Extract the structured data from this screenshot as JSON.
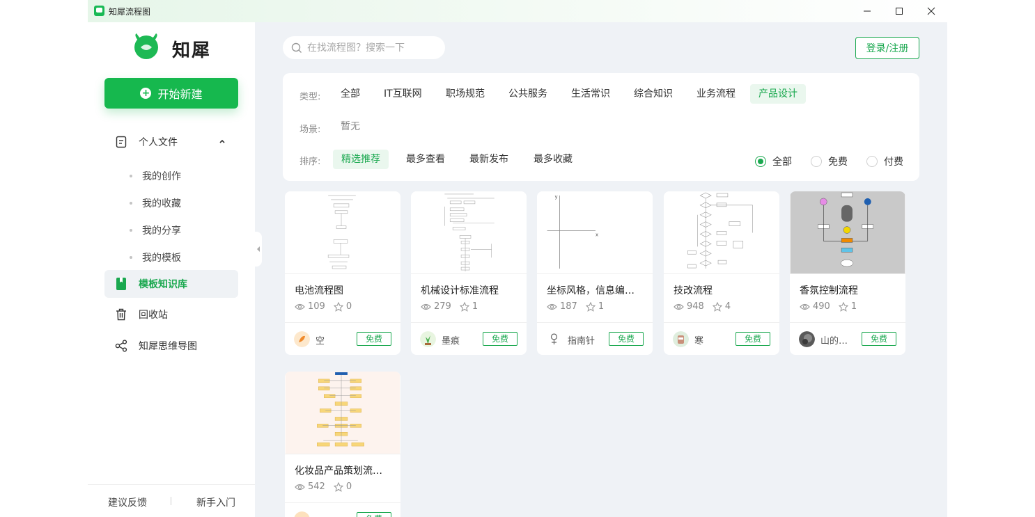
{
  "window": {
    "title": "知犀流程图",
    "controls": {
      "minimize": "─",
      "maximize": "☐",
      "close": "✕"
    }
  },
  "sidebar": {
    "logo_text": "知犀",
    "new_button": "开始新建",
    "personal": {
      "label": "个人文件",
      "items": [
        "我的创作",
        "我的收藏",
        "我的分享",
        "我的模板"
      ]
    },
    "template_library": "模板知识库",
    "recycle": "回收站",
    "mindmap": "知犀思维导图",
    "footer": {
      "feedback": "建议反馈",
      "guide": "新手入门"
    }
  },
  "header": {
    "search_placeholder": "在找流程图？搜索一下",
    "login": "登录/注册"
  },
  "filters": {
    "type_label": "类型:",
    "types": [
      "全部",
      "IT互联网",
      "职场规范",
      "公共服务",
      "生活常识",
      "综合知识",
      "业务流程",
      "产品设计"
    ],
    "selected_type": "产品设计",
    "scene_label": "场景:",
    "scene_value": "暂无",
    "sort_label": "排序:",
    "sorts": [
      "精选推荐",
      "最多查看",
      "最新发布",
      "最多收藏"
    ],
    "selected_sort": "精选推荐",
    "price": [
      "全部",
      "免费",
      "付费"
    ],
    "selected_price": "全部"
  },
  "cards": [
    {
      "title": "电池流程图",
      "views": "109",
      "stars": "0",
      "author": "空",
      "badge": "免费",
      "thumb": "flow-sparse"
    },
    {
      "title": "机械设计标准流程",
      "views": "279",
      "stars": "1",
      "author": "墨痕",
      "badge": "免费",
      "thumb": "flow-dense"
    },
    {
      "title": "坐标风格，信息编…",
      "views": "187",
      "stars": "1",
      "author": "指南针",
      "badge": "免费",
      "thumb": "axes"
    },
    {
      "title": "技改流程",
      "views": "948",
      "stars": "4",
      "author": "寒",
      "badge": "免费",
      "thumb": "flow-diamond"
    },
    {
      "title": "香氛控制流程",
      "views": "490",
      "stars": "1",
      "author": "山的…",
      "badge": "免费",
      "thumb": "flow-gray"
    },
    {
      "title": "化妆品产品策划流…",
      "views": "542",
      "stars": "0",
      "author": " ",
      "badge": "免费",
      "thumb": "flow-yellow"
    }
  ],
  "colors": {
    "accent": "#1aa84f",
    "button": "#16b84e",
    "content_bg": "#eff2f6"
  },
  "axis_labels": {
    "y": "y",
    "x": "x"
  }
}
